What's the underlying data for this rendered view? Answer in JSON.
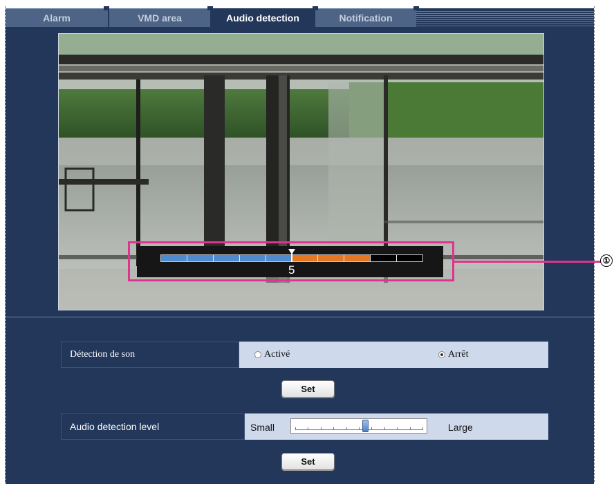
{
  "tabs": [
    {
      "label": "Alarm",
      "active": false
    },
    {
      "label": "VMD area",
      "active": false
    },
    {
      "label": "Audio detection",
      "active": true
    },
    {
      "label": "Notification",
      "active": false
    }
  ],
  "level_meter": {
    "value": "5",
    "level": 5,
    "segments": 10,
    "colors": {
      "low": "#4f8bd0",
      "high": "#e87820",
      "off": "#000000"
    },
    "orange_segments": 3
  },
  "callout": {
    "number": "①"
  },
  "audio_detection": {
    "label": "Détection de son",
    "option_on": "Activé",
    "option_off": "Arrêt",
    "selected": "Arrêt"
  },
  "set_label": "Set",
  "audio_level": {
    "label": "Audio detection level",
    "min_label": "Small",
    "max_label": "Large",
    "value_fraction": 0.55,
    "ticks": 10
  },
  "colors": {
    "panel": "#22375a",
    "callout": "#e0338f",
    "row_value_bg": "#cfd9ec"
  }
}
